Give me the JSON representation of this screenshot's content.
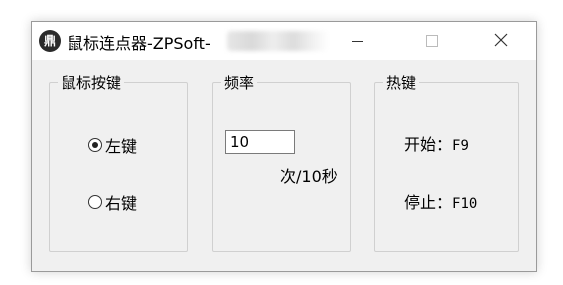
{
  "window": {
    "title": "鼠标连点器-ZPSoft-",
    "icon_name": "app-logo-icon",
    "icon_glyph": "鼎",
    "controls": {
      "minimize": "minimize-icon",
      "maximize": "maximize-icon",
      "close": "close-icon"
    }
  },
  "mouse_button_group": {
    "legend": "鼠标按键",
    "options": [
      {
        "label": "左键",
        "checked": true
      },
      {
        "label": "右键",
        "checked": false
      }
    ]
  },
  "frequency_group": {
    "legend": "频率",
    "value": "10",
    "unit": "次/10秒"
  },
  "hotkey_group": {
    "legend": "热键",
    "start_label": "开始：",
    "start_key": "F9",
    "stop_label": "停止：",
    "stop_key": "F10"
  }
}
